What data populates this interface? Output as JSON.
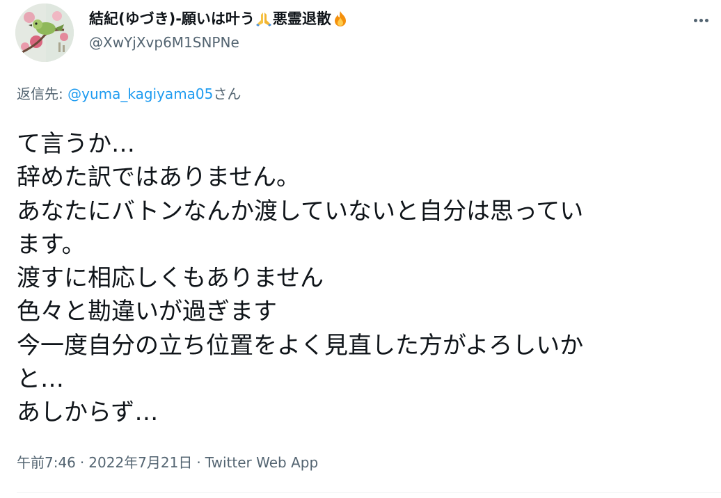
{
  "author": {
    "display_name_part1": "結紀(ゆづき)-願いは叶う",
    "display_name_part2": "悪霊退散",
    "emoji_1": "folded-hands-icon",
    "emoji_2": "fire-icon",
    "handle": "@XwYjXvp6M1SNPNe"
  },
  "reply": {
    "prefix": "返信先: ",
    "mention": "@yuma_kagiyama05",
    "suffix": "さん"
  },
  "body": {
    "lines": [
      "て言うか…",
      "辞めた訳ではありません。",
      "あなたにバトンなんか渡していないと自分は思ってい",
      "ます。",
      "渡すに相応しくもありません",
      "色々と勘違いが過ぎます",
      "今一度自分の立ち位置をよく見直した方がよろしいか",
      "と…",
      "あしからず…"
    ]
  },
  "meta": {
    "time": "午前7:46",
    "separator": "·",
    "date": "2022年7月21日",
    "source": "Twitter Web App"
  },
  "colors": {
    "text": "#0f1419",
    "secondary": "#536471",
    "link": "#1d9bf0",
    "divider": "#eff3f4"
  }
}
